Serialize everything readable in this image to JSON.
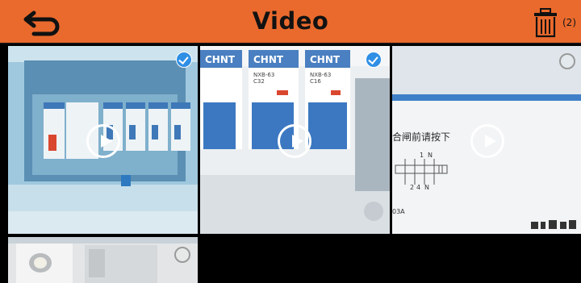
{
  "header": {
    "title": "Video",
    "selected_count": "(2)",
    "background": "#ea6a2d",
    "back_icon": "back-arrow-icon",
    "trash_icon": "trash-icon"
  },
  "videos": [
    {
      "name": "video-1",
      "selected": true
    },
    {
      "name": "video-2",
      "selected": true,
      "labels": [
        "CHNT",
        "CHNT",
        "CHNT",
        "NXB-63",
        "NXB-63",
        "C32",
        "C16"
      ]
    },
    {
      "name": "video-3",
      "selected": false,
      "labels": [
        "合闸前请按下",
        "1",
        "N",
        "2",
        "4",
        "N",
        "03A"
      ]
    },
    {
      "name": "video-4",
      "selected": false
    }
  ],
  "colors": {
    "selected_check": "#2f8fe5",
    "play_icon": "#ffffff"
  }
}
